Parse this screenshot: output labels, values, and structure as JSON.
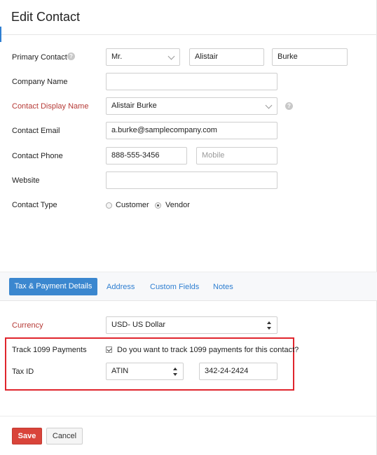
{
  "page": {
    "title": "Edit Contact"
  },
  "form": {
    "primary_contact": {
      "label": "Primary Contact",
      "salutation": "Mr.",
      "first_name": "Alistair",
      "last_name": "Burke"
    },
    "company_name": {
      "label": "Company Name",
      "value": ""
    },
    "display_name": {
      "label": "Contact Display Name",
      "value": "Alistair Burke"
    },
    "email": {
      "label": "Contact Email",
      "value": "a.burke@samplecompany.com"
    },
    "phone": {
      "label": "Contact Phone",
      "work": "888-555-3456",
      "mobile_placeholder": "Mobile"
    },
    "website": {
      "label": "Website",
      "value": ""
    },
    "contact_type": {
      "label": "Contact Type",
      "options": [
        "Customer",
        "Vendor"
      ],
      "selected": "Vendor"
    }
  },
  "tabs": [
    {
      "label": "Tax & Payment Details",
      "active": true
    },
    {
      "label": "Address",
      "active": false
    },
    {
      "label": "Custom Fields",
      "active": false
    },
    {
      "label": "Notes",
      "active": false
    }
  ],
  "tax": {
    "currency": {
      "label": "Currency",
      "value": "USD- US Dollar"
    },
    "track_1099": {
      "label": "Track 1099 Payments",
      "checkbox_text": "Do you want to track 1099 payments for this contact?",
      "checked": true
    },
    "tax_id": {
      "label": "Tax ID",
      "type": "ATIN",
      "value": "342-24-2424"
    }
  },
  "footer": {
    "save_label": "Save",
    "cancel_label": "Cancel"
  },
  "colors": {
    "accent": "#3b87cf",
    "required_label": "#b63a36",
    "save_button": "#d9443a",
    "highlight_box": "#e0252d"
  }
}
